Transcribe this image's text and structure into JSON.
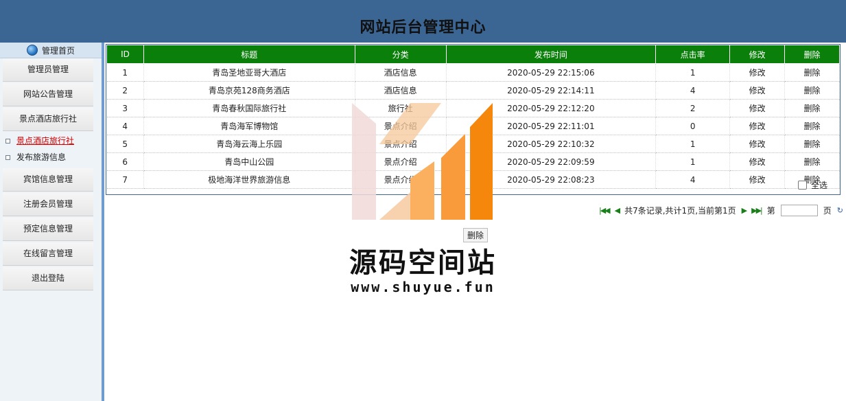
{
  "header": {
    "title": "网站后台管理中心"
  },
  "sidebar": {
    "home_label": "管理首页",
    "menu": [
      {
        "label": "管理员管理"
      },
      {
        "label": "网站公告管理"
      },
      {
        "label": "景点酒店旅行社"
      }
    ],
    "submenu": [
      {
        "label": "景点酒店旅行社",
        "active": true
      },
      {
        "label": "发布旅游信息",
        "active": false
      }
    ],
    "menu2": [
      {
        "label": "宾馆信息管理"
      },
      {
        "label": "注册会员管理"
      },
      {
        "label": "预定信息管理"
      },
      {
        "label": "在线留言管理"
      },
      {
        "label": "退出登陆"
      }
    ]
  },
  "table": {
    "columns": [
      "ID",
      "标题",
      "分类",
      "发布时间",
      "点击率",
      "修改",
      "删除"
    ],
    "rows": [
      {
        "id": "1",
        "title": "青岛圣地亚哥大酒店",
        "category": "酒店信息",
        "time": "2020-05-29 22:15:06",
        "clicks": "1",
        "edit": "修改",
        "del": "删除"
      },
      {
        "id": "2",
        "title": "青岛京苑128商务酒店",
        "category": "酒店信息",
        "time": "2020-05-29 22:14:11",
        "clicks": "4",
        "edit": "修改",
        "del": "删除"
      },
      {
        "id": "3",
        "title": "青岛春秋国际旅行社",
        "category": "旅行社",
        "time": "2020-05-29 22:12:20",
        "clicks": "2",
        "edit": "修改",
        "del": "删除"
      },
      {
        "id": "4",
        "title": "青岛海军博物馆",
        "category": "景点介绍",
        "time": "2020-05-29 22:11:01",
        "clicks": "0",
        "edit": "修改",
        "del": "删除"
      },
      {
        "id": "5",
        "title": "青岛海云海上乐园",
        "category": "景点介绍",
        "time": "2020-05-29 22:10:32",
        "clicks": "1",
        "edit": "修改",
        "del": "删除"
      },
      {
        "id": "6",
        "title": "青岛中山公园",
        "category": "景点介绍",
        "time": "2020-05-29 22:09:59",
        "clicks": "1",
        "edit": "修改",
        "del": "删除"
      },
      {
        "id": "7",
        "title": "极地海洋世界旅游信息",
        "category": "景点介绍",
        "time": "2020-05-29 22:08:23",
        "clicks": "4",
        "edit": "修改",
        "del": "删除"
      }
    ],
    "select_all_label": "全选"
  },
  "pager": {
    "summary": "共7条记录,共计1页,当前第1页",
    "goto_label": "第",
    "page_suffix": "页",
    "icons": [
      "first-page-icon",
      "prev-page-icon",
      "next-page-icon",
      "last-page-icon",
      "refresh-icon"
    ]
  },
  "delete_button": "删除",
  "watermark": {
    "title": "源码空间站",
    "url": "www.shuyue.fun"
  }
}
